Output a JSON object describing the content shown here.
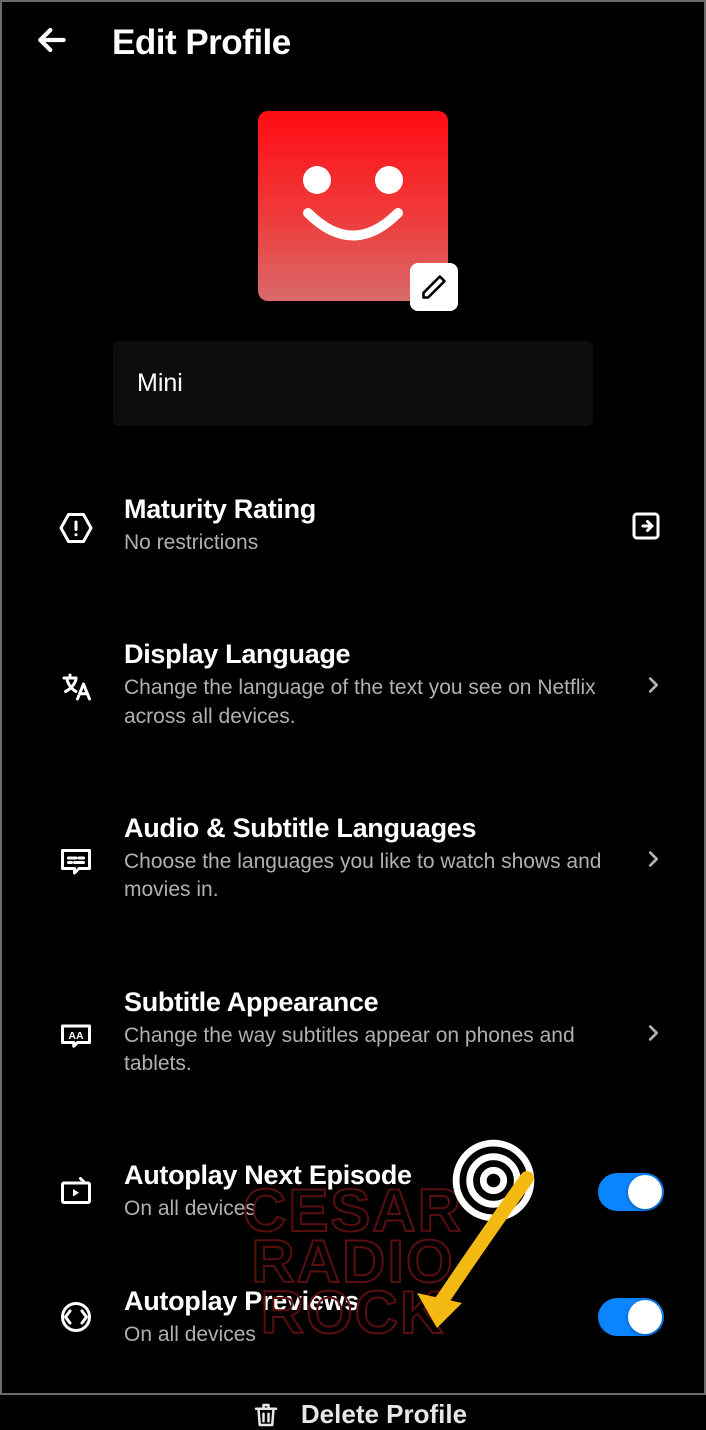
{
  "header": {
    "title": "Edit Profile"
  },
  "profile": {
    "name": "Mini"
  },
  "settings": {
    "maturity": {
      "title": "Maturity Rating",
      "subtitle": "No restrictions"
    },
    "displayLanguage": {
      "title": "Display Language",
      "subtitle": "Change the language of the text you see on Netflix across all devices."
    },
    "audioSubtitle": {
      "title": "Audio & Subtitle Languages",
      "subtitle": "Choose the languages you like to watch shows and movies in."
    },
    "subtitleAppearance": {
      "title": "Subtitle Appearance",
      "subtitle": "Change the way subtitles appear on phones and tablets."
    },
    "autoplayNext": {
      "title": "Autoplay Next Episode",
      "subtitle": "On all devices",
      "enabled": true
    },
    "autoplayPreviews": {
      "title": "Autoplay Previews",
      "subtitle": "On all devices",
      "enabled": true
    }
  },
  "delete": {
    "label": "Delete Profile"
  },
  "watermark": {
    "line1": "CESAR",
    "line2": "RADIO",
    "line3": "ROCK"
  }
}
